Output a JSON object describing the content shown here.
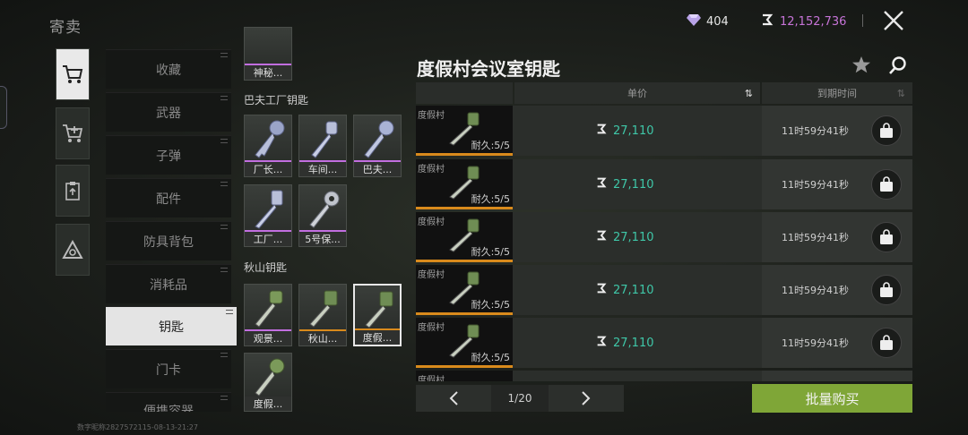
{
  "header": {
    "title": "寄卖",
    "gem_count": "404",
    "money": "12,152,736"
  },
  "categories": [
    "收藏",
    "武器",
    "子弹",
    "配件",
    "防具背包",
    "消耗品",
    "钥匙",
    "门卡",
    "便携容器"
  ],
  "active_category": "钥匙",
  "grid": {
    "top_partial_label": "神秘...",
    "section1_title": "巴夫工厂钥匙",
    "section1_items": [
      "厂长...",
      "车间...",
      "巴夫...",
      "工厂...",
      "5号保..."
    ],
    "section2_title": "秋山钥匙",
    "section2_items": [
      "观景...",
      "秋山...",
      "度假...",
      "度假..."
    ]
  },
  "detail": {
    "title": "度假村会议室钥匙",
    "col_price": "单价",
    "col_expire": "到期时间",
    "rows": [
      {
        "name": "度假村",
        "durability": "耐久:5/5",
        "price": "27,110",
        "expire": "11时59分41秒"
      },
      {
        "name": "度假村",
        "durability": "耐久:5/5",
        "price": "27,110",
        "expire": "11时59分41秒"
      },
      {
        "name": "度假村",
        "durability": "耐久:5/5",
        "price": "27,110",
        "expire": "11时59分41秒"
      },
      {
        "name": "度假村",
        "durability": "耐久:5/5",
        "price": "27,110",
        "expire": "11时59分41秒"
      },
      {
        "name": "度假村",
        "durability": "耐久:5/5",
        "price": "27,110",
        "expire": "11时59分41秒"
      }
    ],
    "partial_row_name": "度假村"
  },
  "pagination": {
    "page": "1/20"
  },
  "buy_all_label": "批量购买",
  "footer_uid": "数字昵称2827572115-08-13-21:27",
  "colors": {
    "accent_green": "#7fa637",
    "price_teal": "#3fc7a8",
    "money_purple": "#c774d8",
    "rarity_purple": "#c26ee0",
    "rarity_orange": "#d98a1c"
  }
}
